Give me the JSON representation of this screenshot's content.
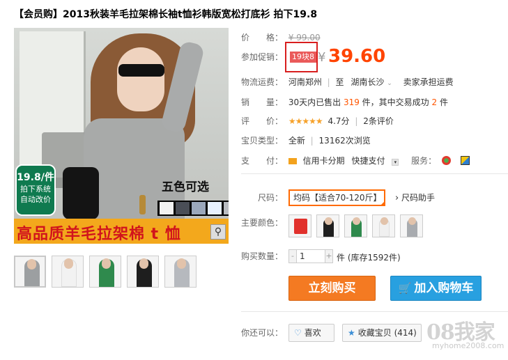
{
  "product": {
    "title": "【会员购】2013秋装羊毛拉架棉长袖t恤衫韩版宽松打底衫 拍下19.8"
  },
  "gallery": {
    "badge_price": "19.8/件",
    "badge_line1": "拍下系统",
    "badge_line2": "自动改价",
    "five_colors": "五色可选",
    "banner_text": "高品质羊毛拉架棉 t 恤",
    "swatch_colors": [
      "#f2f2f2",
      "#4a4e57",
      "#9aa7bb",
      "#e8f1ff",
      "#b9bcc1"
    ],
    "thumbnails": [
      {
        "color": "#9c9fa1"
      },
      {
        "color": "#f2f2f2"
      },
      {
        "color": "#2f8a4d"
      },
      {
        "color": "#1e1e1e"
      },
      {
        "color": "#b6b9be"
      }
    ]
  },
  "details": {
    "price_label": "价　　格：",
    "original_price": "¥ 99.00",
    "promo_label": "参加促销：",
    "promo_tag": "19块8",
    "yen": "¥",
    "promo_price": "39.60",
    "shipping_label": "物流运费：",
    "shipping_from": "河南郑州",
    "shipping_to_prefix": "至",
    "shipping_to": "湖南长沙",
    "shipping_note": "卖家承担运费",
    "sales_label": "销　　量：",
    "sales_text_a": "30天内已售出",
    "sales_count": "319",
    "sales_text_b": "件，其中交易成功",
    "sales_success": "2",
    "sales_text_c": "件",
    "rating_label": "评　　价：",
    "stars": "★★★★★",
    "rating_score": "4.7分",
    "rating_reviews": "2条评价",
    "type_label": "宝贝类型：",
    "type_value": "全新",
    "views": "13162次浏览",
    "pay_label": "支　　付：",
    "pay_credit": "信用卡分期",
    "pay_quick": "快捷支付",
    "service_label": "服务："
  },
  "options": {
    "size_label": "尺码：",
    "size_value": "均码【适合70-120斤】",
    "size_helper": "尺码助手",
    "color_label": "主要颜色：",
    "colors": [
      {
        "color": "#e1312c"
      },
      {
        "color": "#1f1f1f"
      },
      {
        "color": "#2f8a4d"
      },
      {
        "color": "#f0f0f0"
      },
      {
        "color": "#a8abaf"
      }
    ],
    "qty_label": "购买数量：",
    "qty_minus": "-",
    "qty_value": "1",
    "qty_plus": "+",
    "stock_text": "件 (库存1592件)"
  },
  "actions": {
    "buy_now": "立刻购买",
    "add_to_cart": "加入购物车",
    "you_can_label": "你还可以：",
    "like": "喜欢",
    "favorite": "收藏宝贝 (414)"
  },
  "watermark": {
    "logo": "08我家",
    "site": "myhome2008.com"
  }
}
